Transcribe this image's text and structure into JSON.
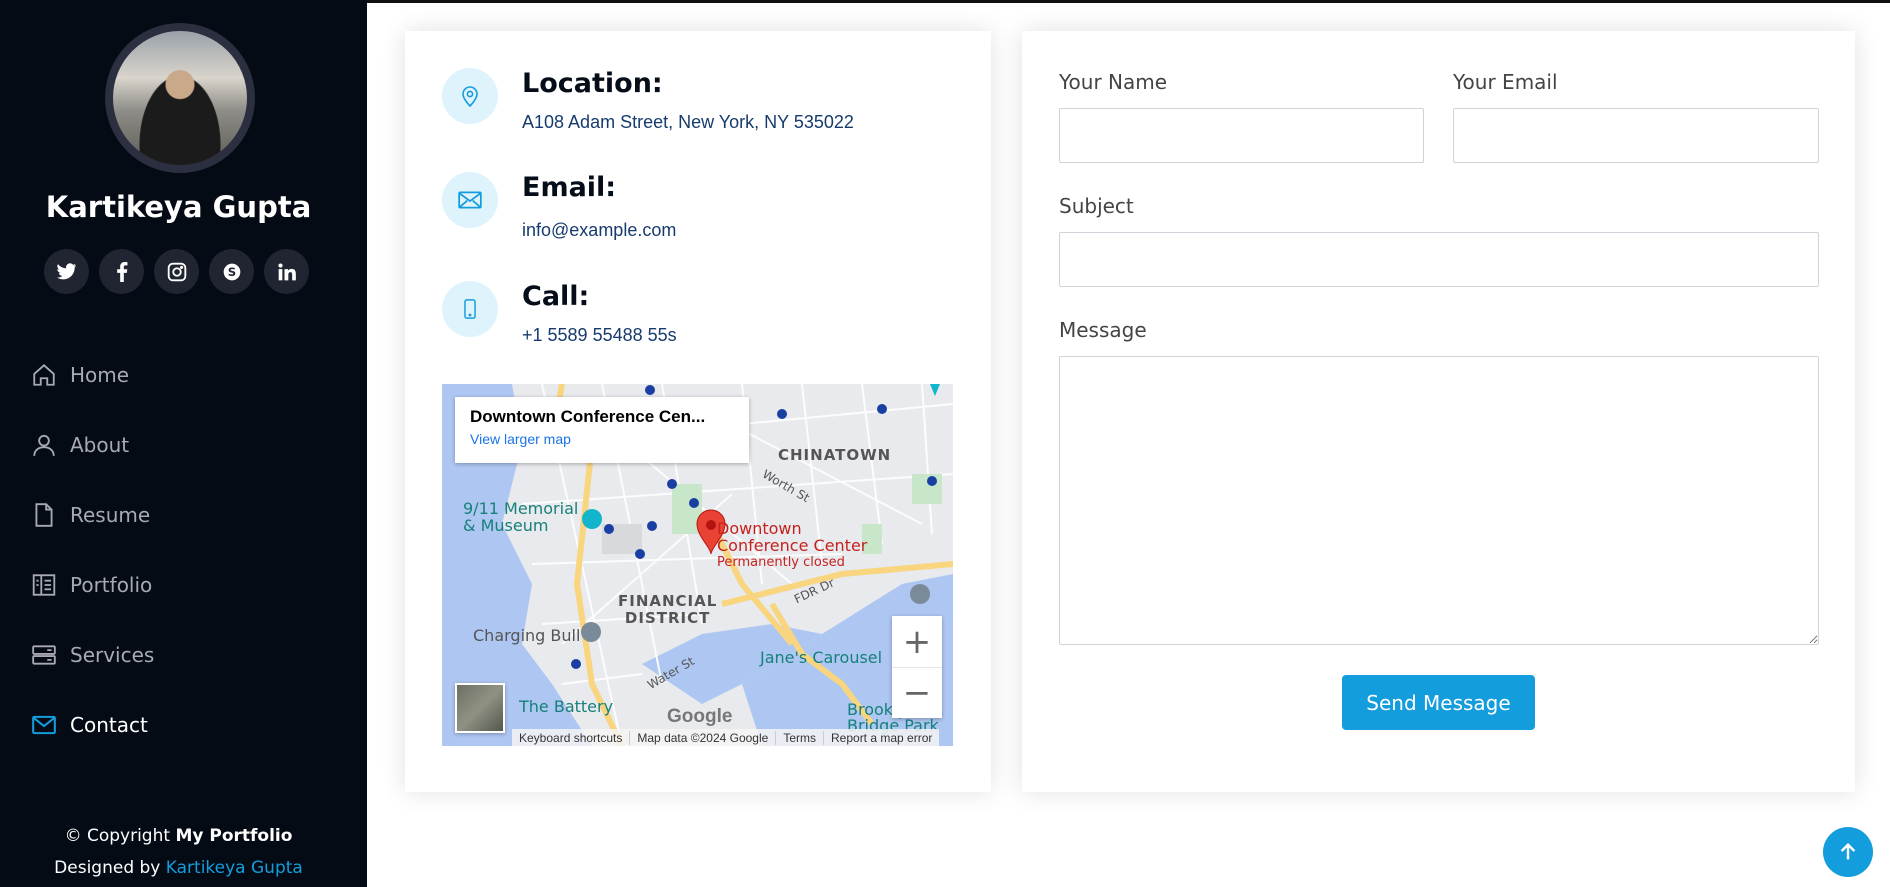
{
  "profile": {
    "name": "Kartikeya Gupta",
    "socials": [
      {
        "icon": "twitter-icon",
        "glyph": "🐦"
      },
      {
        "icon": "facebook-icon",
        "glyph": "f"
      },
      {
        "icon": "instagram-icon",
        "glyph": "◎"
      },
      {
        "icon": "skype-icon",
        "glyph": "S"
      },
      {
        "icon": "linkedin-icon",
        "glyph": "in"
      }
    ]
  },
  "nav": {
    "items": [
      {
        "label": "Home",
        "icon": "home-icon"
      },
      {
        "label": "About",
        "icon": "person-icon"
      },
      {
        "label": "Resume",
        "icon": "file-icon"
      },
      {
        "label": "Portfolio",
        "icon": "book-icon"
      },
      {
        "label": "Services",
        "icon": "server-icon"
      },
      {
        "label": "Contact",
        "icon": "envelope-icon",
        "active": true
      }
    ]
  },
  "footer": {
    "copyright_prefix": "© Copyright ",
    "copyright_brand": "My Portfolio",
    "designed_prefix": "Designed by ",
    "designer": "Kartikeya Gupta"
  },
  "contact_info": {
    "location_title": "Location:",
    "location_text": "A108 Adam Street, New York, NY 535022",
    "email_title": "Email:",
    "email_text": "info@example.com",
    "call_title": "Call:",
    "call_text": "+1 5589 55488 55s"
  },
  "map": {
    "place": "Downtown Conference Cen...",
    "view_larger": "View larger map",
    "zoom_in": "+",
    "zoom_out": "−",
    "logo": "Google",
    "bar": [
      "Keyboard shortcuts",
      "Map data ©2024 Google",
      "Terms",
      "Report a map error"
    ],
    "labels": {
      "chinatown": "CHINATOWN",
      "memorial_1": "9/11 Memorial",
      "memorial_2": "& Museum",
      "marker_1": "Downtown",
      "marker_2": "Conference Center",
      "marker_3": "Permanently closed",
      "financial_1": "FINANCIAL",
      "financial_2": "DISTRICT",
      "fdr": "FDR Dr",
      "worth": "Worth St",
      "water": "Water St",
      "bull": "Charging Bull",
      "carousel": "Jane's Carousel",
      "battery": "The Battery",
      "brooklyn_1": "Brooklyn",
      "brooklyn_2": "Bridge Park"
    }
  },
  "form": {
    "name_label": "Your Name",
    "email_label": "Your Email",
    "subject_label": "Subject",
    "message_label": "Message",
    "send_label": "Send Message"
  },
  "colors": {
    "accent": "#149ddd",
    "sidebar_bg": "#040b14",
    "heading": "#050d18",
    "text": "#173b6c"
  }
}
